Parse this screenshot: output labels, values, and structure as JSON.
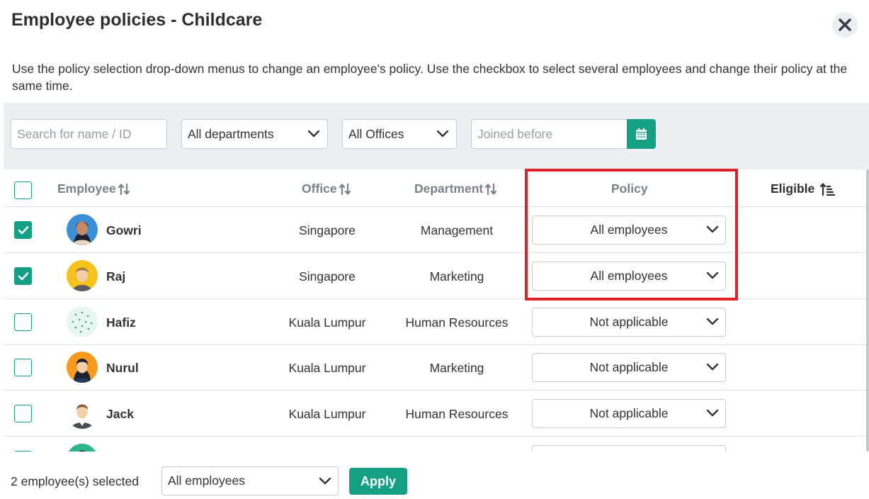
{
  "dialog": {
    "title": "Employee policies - Childcare",
    "description": "Use the policy selection drop-down menus to change an employee's policy. Use the checkbox to select several employees and change their policy at the same time."
  },
  "filters": {
    "search_placeholder": "Search for name / ID",
    "department": "All departments",
    "office": "All Offices",
    "joined_placeholder": "Joined before"
  },
  "table": {
    "headers": {
      "employee": "Employee",
      "office": "Office",
      "department": "Department",
      "policy": "Policy",
      "eligible": "Eligible"
    },
    "rows": [
      {
        "name": "Gowri",
        "office": "Singapore",
        "department": "Management",
        "policy": "All employees",
        "checked": true
      },
      {
        "name": "Raj",
        "office": "Singapore",
        "department": "Marketing",
        "policy": "All employees",
        "checked": true
      },
      {
        "name": "Hafiz",
        "office": "Kuala Lumpur",
        "department": "Human Resources",
        "policy": "Not applicable",
        "checked": false
      },
      {
        "name": "Nurul",
        "office": "Kuala Lumpur",
        "department": "Marketing",
        "policy": "Not applicable",
        "checked": false
      },
      {
        "name": "Jack",
        "office": "Kuala Lumpur",
        "department": "Human Resources",
        "policy": "Not applicable",
        "checked": false
      }
    ]
  },
  "footer": {
    "selected_text": "2 employee(s) selected",
    "bulk_policy": "All employees",
    "apply_label": "Apply"
  },
  "colors": {
    "accent": "#14a085",
    "highlight": "#e02128"
  }
}
